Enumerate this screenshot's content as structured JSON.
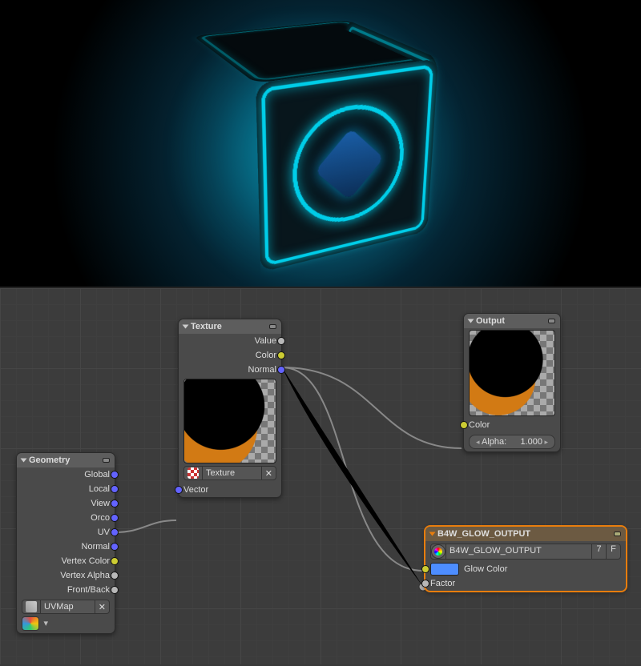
{
  "preview_description": "3D render of a black cube with glowing cyan neon edges and circular logo emblem on front face, floating against a dark radial gradient background",
  "geometry_node": {
    "title": "Geometry",
    "outputs": [
      "Global",
      "Local",
      "View",
      "Orco",
      "UV",
      "Normal",
      "Vertex Color",
      "Vertex Alpha",
      "Front/Back"
    ],
    "uv_map": "UVMap"
  },
  "texture_node": {
    "title": "Texture",
    "outputs": [
      "Value",
      "Color",
      "Normal"
    ],
    "texture_name": "Texture",
    "input": "Vector"
  },
  "output_node": {
    "title": "Output",
    "inputs": {
      "color": "Color",
      "alpha_label": "Alpha:",
      "alpha_value": "1.000"
    }
  },
  "glow_node": {
    "title": "B4W_GLOW_OUTPUT",
    "group_name": "B4W_GLOW_OUTPUT",
    "users": "7",
    "fake_user": "F",
    "inputs": {
      "glow_color": "Glow Color",
      "factor": "Factor"
    },
    "glow_swatch": "#4d8dff"
  }
}
